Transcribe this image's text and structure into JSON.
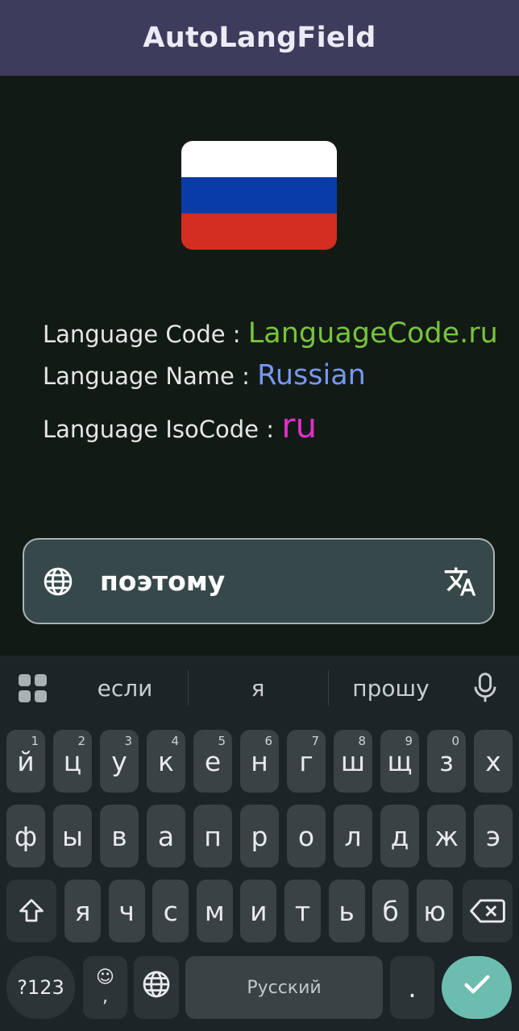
{
  "app_bar": {
    "title": "AutoLangField"
  },
  "flag": {
    "country": "Russia",
    "colors": [
      "#ffffff",
      "#0a3ca8",
      "#d42e22"
    ]
  },
  "info": {
    "code_label": "Language Code : ",
    "code_value": "LanguageCode.ru",
    "name_label": "Language Name : ",
    "name_value": "Russian",
    "iso_label": "Language IsoCode : ",
    "iso_value": "ru"
  },
  "colors": {
    "code": "#79c33c",
    "name": "#7797f0",
    "iso": "#e030c8",
    "enter": "#6cbdb0"
  },
  "input": {
    "value": "поэтому",
    "leading_icon": "globe-icon",
    "trailing_icon": "translate-icon"
  },
  "keyboard": {
    "suggestions": [
      "если",
      "я",
      "прошу"
    ],
    "row1": [
      {
        "k": "й",
        "h": "1"
      },
      {
        "k": "ц",
        "h": "2"
      },
      {
        "k": "у",
        "h": "3"
      },
      {
        "k": "к",
        "h": "4"
      },
      {
        "k": "е",
        "h": "5"
      },
      {
        "k": "н",
        "h": "6"
      },
      {
        "k": "г",
        "h": "7"
      },
      {
        "k": "ш",
        "h": "8"
      },
      {
        "k": "щ",
        "h": "9"
      },
      {
        "k": "з",
        "h": "0"
      },
      {
        "k": "х",
        "h": ""
      }
    ],
    "row2": [
      "ф",
      "ы",
      "в",
      "а",
      "п",
      "р",
      "о",
      "л",
      "д",
      "ж",
      "э"
    ],
    "row3": [
      "я",
      "ч",
      "с",
      "м",
      "и",
      "т",
      "ь",
      "б",
      "ю"
    ],
    "symbols_label": "?123",
    "emoji_top": "☺",
    "emoji_bottom": ",",
    "space_label": "Русский",
    "period_label": "."
  }
}
